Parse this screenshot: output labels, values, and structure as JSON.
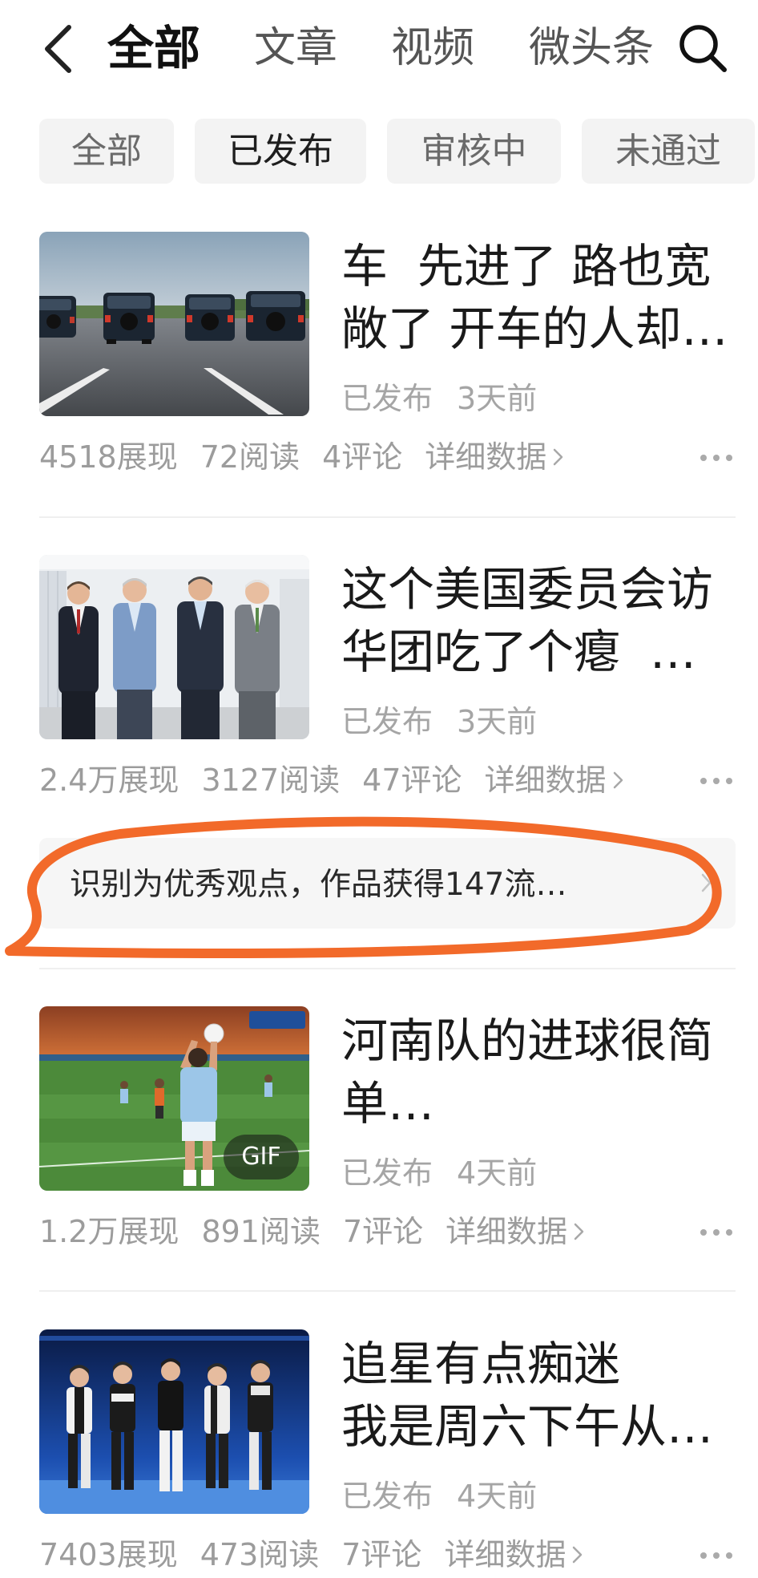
{
  "nav": {
    "back_icon": "chevron-left-icon",
    "tabs": [
      "全部",
      "文章",
      "视频",
      "微头条"
    ],
    "active_tab": "全部",
    "search_icon": "search-icon"
  },
  "filters": {
    "items": [
      "全部",
      "已发布",
      "审核中",
      "未通过"
    ],
    "selected": "已发布"
  },
  "articles": [
    {
      "title_lines": [
        "车  先进了 路也宽",
        "敞了 开车的人却…"
      ],
      "status": "已发布",
      "time": "3天前",
      "views": "4518展现",
      "reads": "72阅读",
      "comments": "4评论",
      "details": "详细数据"
    },
    {
      "title_lines": [
        "这个美国委员会访",
        "华团吃了个瘪  …"
      ],
      "status": "已发布",
      "time": "3天前",
      "views": "2.4万展现",
      "reads": "3127阅读",
      "comments": "47评论",
      "details": "详细数据"
    },
    {
      "title_lines": [
        "河南队的进球很简",
        "单…"
      ],
      "status": "已发布",
      "time": "4天前",
      "views": "1.2万展现",
      "reads": "891阅读",
      "comments": "7评论",
      "details": "详细数据",
      "badge": "GIF"
    },
    {
      "title_lines": [
        "追星有点痴迷",
        "我是周六下午从…"
      ],
      "status": "已发布",
      "time": "4天前",
      "views": "7403展现",
      "reads": "473阅读",
      "comments": "7评论",
      "details": "详细数据"
    }
  ],
  "highlight": {
    "text": "识别为优秀观点，作品获得147流…"
  },
  "icons": {
    "details": "chevron-right-icon",
    "more": "more-icon"
  },
  "colors": {
    "annotation": "#f26a2a",
    "chip_bg": "#f3f3f3",
    "meta_text": "#9c9c9c"
  }
}
